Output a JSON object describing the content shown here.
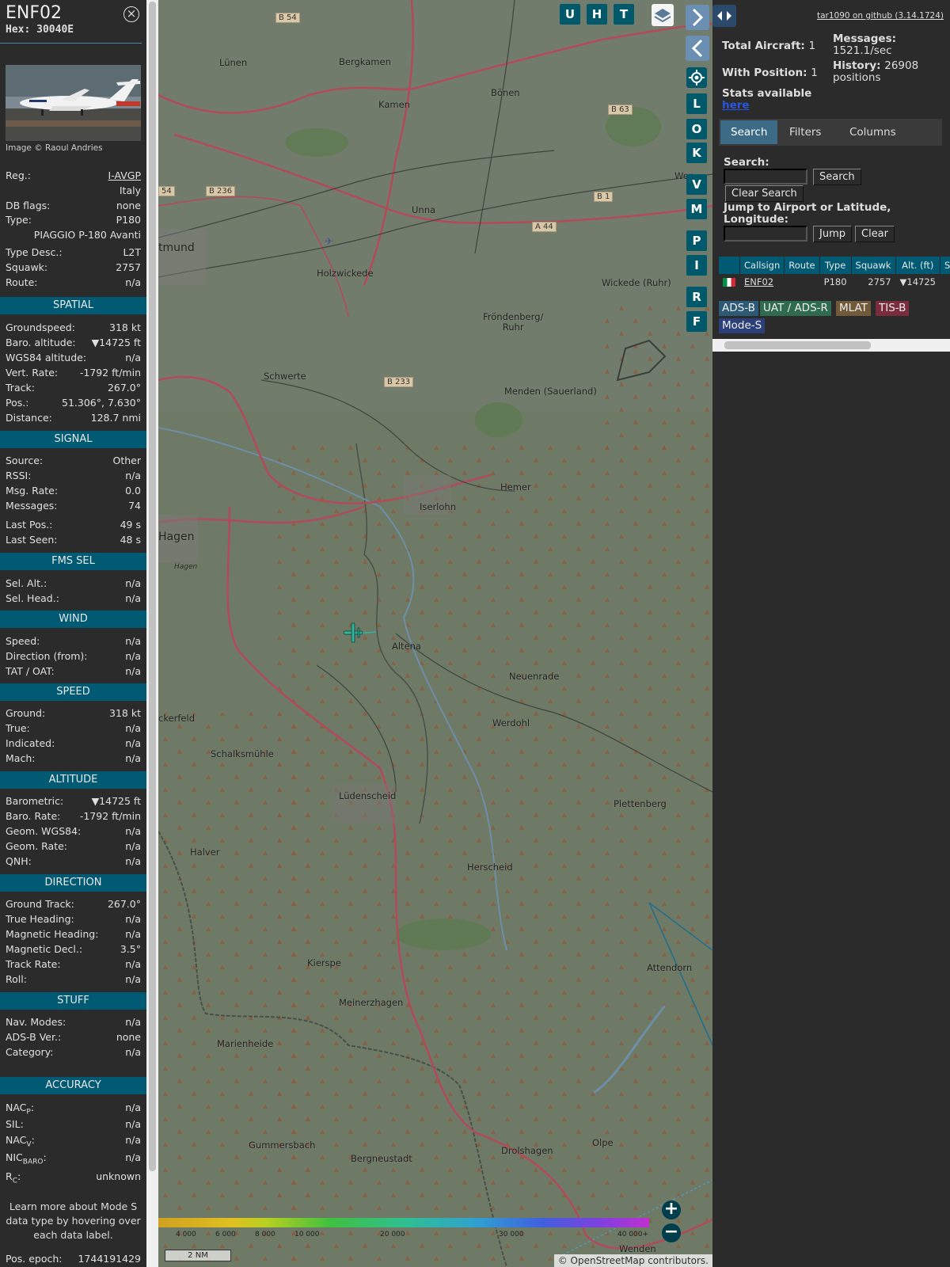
{
  "aircraft": {
    "callsign": "ENF02",
    "hex_label": "Hex: 30040E",
    "image_credit": "Image © Raoul Andries",
    "reg_label": "Reg.:",
    "reg": "I-AVGP",
    "country": "Italy",
    "dbflags_label": "DB flags:",
    "dbflags": "none",
    "type_label": "Type:",
    "type": "P180",
    "type_full": "PIAGGIO P-180 Avanti",
    "typedesc_label": "Type Desc.:",
    "typedesc": "L2T",
    "squawk_label": "Squawk:",
    "squawk": "2757",
    "route_label": "Route:",
    "route": "n/a"
  },
  "sections": {
    "spatial": "SPATIAL",
    "signal": "SIGNAL",
    "fms": "FMS SEL",
    "wind": "WIND",
    "speed": "SPEED",
    "altitude": "ALTITUDE",
    "direction": "DIRECTION",
    "stuff": "STUFF",
    "accuracy": "ACCURACY"
  },
  "spatial": [
    {
      "label": "Groundspeed:",
      "value": "318 kt"
    },
    {
      "label": "Baro. altitude:",
      "value": "▼14725 ft"
    },
    {
      "label": "WGS84 altitude:",
      "value": "n/a"
    },
    {
      "label": "Vert. Rate:",
      "value": "-1792 ft/min"
    },
    {
      "label": "Track:",
      "value": "267.0°"
    },
    {
      "label": "Pos.:",
      "value": "51.306°, 7.630°"
    },
    {
      "label": "Distance:",
      "value": "128.7 nmi"
    }
  ],
  "signal": [
    {
      "label": "Source:",
      "value": "Other"
    },
    {
      "label": "RSSI:",
      "value": "n/a"
    },
    {
      "label": "Msg. Rate:",
      "value": "0.0"
    },
    {
      "label": "Messages:",
      "value": "74"
    },
    {
      "label": "Last Pos.:",
      "value": "49 s"
    },
    {
      "label": "Last Seen:",
      "value": "48 s"
    }
  ],
  "fms": [
    {
      "label": "Sel. Alt.:",
      "value": "n/a"
    },
    {
      "label": "Sel. Head.:",
      "value": "n/a"
    }
  ],
  "wind": [
    {
      "label": "Speed:",
      "value": "n/a"
    },
    {
      "label": "Direction (from):",
      "value": "n/a"
    },
    {
      "label": "TAT / OAT:",
      "value": "n/a"
    }
  ],
  "speed": [
    {
      "label": "Ground:",
      "value": "318 kt"
    },
    {
      "label": "True:",
      "value": "n/a"
    },
    {
      "label": "Indicated:",
      "value": "n/a"
    },
    {
      "label": "Mach:",
      "value": "n/a"
    }
  ],
  "altitude": [
    {
      "label": "Barometric:",
      "value": "▼14725 ft"
    },
    {
      "label": "Baro. Rate:",
      "value": "-1792 ft/min"
    },
    {
      "label": "Geom. WGS84:",
      "value": "n/a"
    },
    {
      "label": "Geom. Rate:",
      "value": "n/a"
    },
    {
      "label": "QNH:",
      "value": "n/a"
    }
  ],
  "direction": [
    {
      "label": "Ground Track:",
      "value": "267.0°"
    },
    {
      "label": "True Heading:",
      "value": "n/a"
    },
    {
      "label": "Magnetic Heading:",
      "value": "n/a"
    },
    {
      "label": "Magnetic Decl.:",
      "value": "3.5°"
    },
    {
      "label": "Track Rate:",
      "value": "n/a"
    },
    {
      "label": "Roll:",
      "value": "n/a"
    }
  ],
  "stuff": [
    {
      "label": "Nav. Modes:",
      "value": "n/a"
    },
    {
      "label": "ADS-B Ver.:",
      "value": "none"
    },
    {
      "label": "Category:",
      "value": "n/a"
    }
  ],
  "accuracy": {
    "nacp_label": "NAC",
    "nacp_sub": "P",
    "nacp": "n/a",
    "sil_label": "SIL:",
    "sil": "n/a",
    "nacv_label": "NAC",
    "nacv_sub": "V",
    "nacv": "n/a",
    "nic_label": "NIC",
    "nic_sub": "BARO",
    "nic": "n/a",
    "rc_label": "R",
    "rc_sub": "C",
    "rc": "unknown"
  },
  "learn_more": "Learn more about Mode S data type by hovering over each data label.",
  "pos_epoch_label": "Pos. epoch:",
  "pos_epoch": "1744191429",
  "map": {
    "buttons": [
      "U",
      "H",
      "T"
    ],
    "side_buttons": [
      "L",
      "O",
      "K",
      "V",
      "M",
      "P",
      "I",
      "R",
      "F"
    ],
    "places": {
      "lunen": "Lünen",
      "bergkamen": "Bergkamen",
      "kamen": "Kamen",
      "bonen": "Bönen",
      "unna": "Unna",
      "dortmund": "tmund",
      "holzwickede": "Holzwickede",
      "wickede": "Wickede (Ruhr)",
      "frondenberg": "Fröndenberg/\nRuhr",
      "schwerte": "Schwerte",
      "menden": "Menden (Sauerland)",
      "hemer": "Hemer",
      "iserlohn": "Iserlohn",
      "hagen": "Hagen",
      "hagen_small": "Hagen",
      "altena": "Altena",
      "neuenrade": "Neuenrade",
      "werdohl": "Werdohl",
      "eckerfeld": "ckerfeld",
      "schalksmuhle": "Schalksmühle",
      "ludenscheid": "Lüdenscheid",
      "plettenberg": "Plettenberg",
      "halver": "Halver",
      "herscheid": "Herscheid",
      "kierspe": "Kierspe",
      "attendorn": "Attendorn",
      "meinerzhagen": "Meinerzhagen",
      "marienheide": "Marienheide",
      "gummersbach": "Gummersbach",
      "bergneustadt": "Bergneustadt",
      "drolshagen": "Drolshagen",
      "olpe": "Olpe",
      "wenden": "Wenden",
      "werl": "Wer"
    },
    "roads": {
      "b54": "B 54",
      "b236": "B 236",
      "b63": "B 63",
      "b1": "B 1",
      "a44": "A 44",
      "b233": "B 233",
      "b54b": "54"
    },
    "altitude_ticks": [
      "4 000",
      "6 000",
      "8 000",
      "10 000",
      "20 000",
      "30 000",
      "40 000+"
    ],
    "scale": "2 NM",
    "attribution": "© OpenStreetMap contributors."
  },
  "sidebar": {
    "github": "tar1090 on github (3.14.1724)",
    "total_aircraft_label": "Total Aircraft:",
    "total_aircraft": "1",
    "with_position_label": "With Position:",
    "with_position": "1",
    "stats_label": "Stats available",
    "stats_link": "here",
    "messages_label": "Messages:",
    "messages": "1521.1/sec",
    "history_label": "History:",
    "history": "26908 positions",
    "tabs": [
      "Search",
      "Filters",
      "Columns"
    ],
    "search_label": "Search:",
    "search_button": "Search",
    "clear_search_button": "Clear Search",
    "jump_label": "Jump to Airport or Latitude, Longitude:",
    "jump_button": "Jump",
    "clear_button": "Clear",
    "table": {
      "headers": [
        "",
        "Callsign",
        "Route",
        "Type",
        "Squawk",
        "Alt. (ft)",
        "Spd"
      ],
      "row": {
        "callsign": "ENF02",
        "route": "",
        "type": "P180",
        "squawk": "2757",
        "alt": "▼14725"
      }
    },
    "legend": [
      "ADS-B",
      "UAT / ADS-R",
      "MLAT",
      "TIS-B",
      "Mode-S"
    ]
  }
}
